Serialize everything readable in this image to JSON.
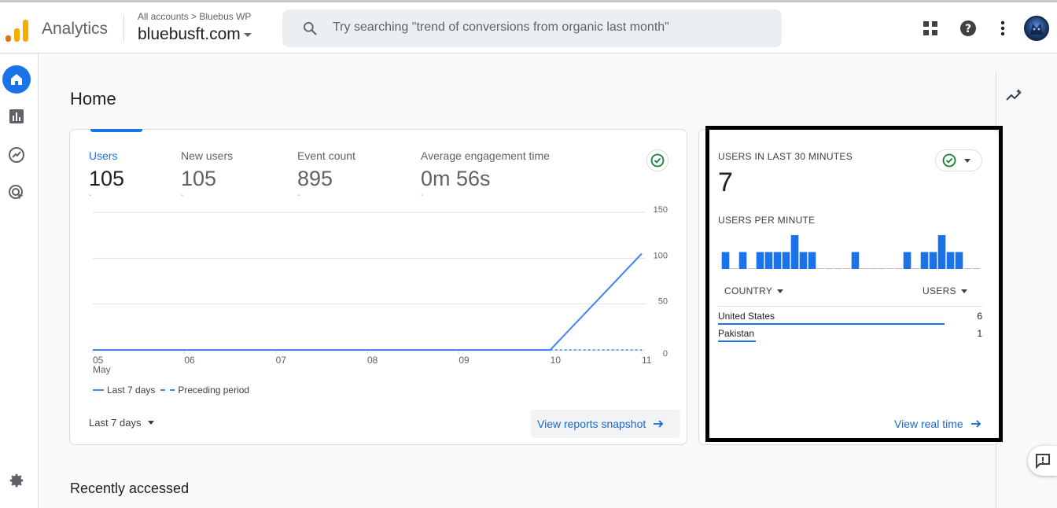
{
  "header": {
    "app_name": "Analytics",
    "breadcrumb": "All accounts > Bluebus WP",
    "property_name": "bluebusft.com",
    "search_placeholder": "Try searching \"trend of conversions from organic last month\""
  },
  "icons": {
    "apps": "grid-icon",
    "help": "help-icon",
    "more": "more-vert-icon",
    "nav": [
      "home-icon",
      "reports-icon",
      "explore-icon",
      "advertising-icon",
      "settings-icon"
    ]
  },
  "page": {
    "title": "Home",
    "recently_accessed": "Recently accessed"
  },
  "overview_card": {
    "metrics": [
      {
        "label": "Users",
        "value": "105",
        "change": "-"
      },
      {
        "label": "New users",
        "value": "105",
        "change": "-"
      },
      {
        "label": "Event count",
        "value": "895",
        "change": "-"
      },
      {
        "label": "Average engagement time",
        "value": "0m 56s",
        "change": "-"
      }
    ],
    "legend": {
      "current": "Last 7 days",
      "previous": "Preceding period"
    },
    "date_range": "Last 7 days",
    "snapshot_link": "View reports snapshot"
  },
  "chart_data": {
    "type": "line",
    "x": [
      "05",
      "06",
      "07",
      "08",
      "09",
      "10",
      "11"
    ],
    "x_sublabel": "May",
    "series": [
      {
        "name": "Last 7 days",
        "values": [
          0,
          0,
          0,
          0,
          0,
          0,
          105
        ]
      },
      {
        "name": "Preceding period",
        "values": [
          null,
          null,
          null,
          null,
          null,
          0,
          0
        ]
      }
    ],
    "y_ticks": [
      0,
      50,
      100,
      150
    ],
    "ylim": [
      0,
      150
    ],
    "grid": true,
    "colors": {
      "current": "#4285f4",
      "previous": "#4285f4"
    }
  },
  "realtime_card": {
    "title": "USERS IN LAST 30 MINUTES",
    "value": "7",
    "per_minute_label": "USERS PER MINUTE",
    "per_minute": [
      1,
      0,
      1,
      0,
      1,
      1,
      1,
      1,
      2,
      1,
      1,
      0,
      0,
      0,
      0,
      1,
      0,
      0,
      0,
      0,
      0,
      1,
      0,
      1,
      1,
      2,
      1,
      1,
      0,
      0
    ],
    "col_country": "COUNTRY",
    "col_users": "USERS",
    "rows": [
      {
        "country": "United States",
        "users": "6",
        "share": 0.857
      },
      {
        "country": "Pakistan",
        "users": "1",
        "share": 0.143
      }
    ],
    "view_link": "View real time"
  },
  "colors": {
    "accent": "#1a73e8",
    "link": "#1967d2",
    "success": "#188038"
  }
}
